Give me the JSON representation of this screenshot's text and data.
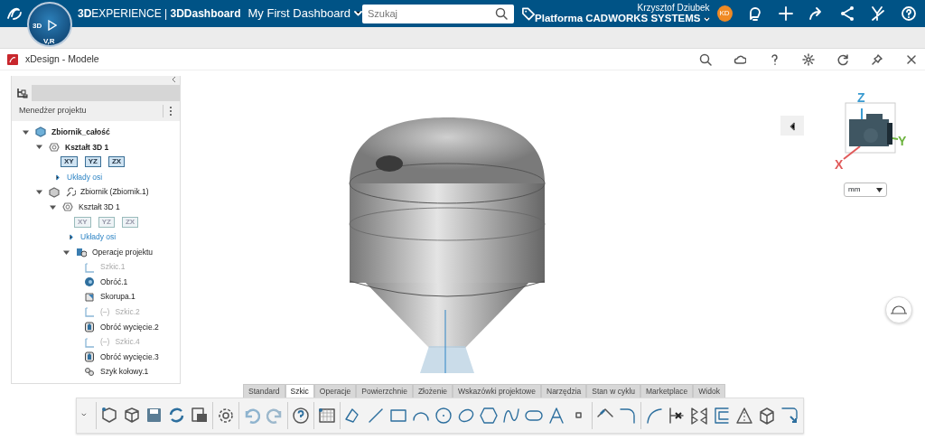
{
  "topbar": {
    "brand": "**3D**EXPERIENCE | **3DDashboard**",
    "dashboard_title": "My First Dashboard",
    "search": {
      "placeholder": "Szukaj"
    },
    "user": {
      "name": "Krzysztof Dziubek",
      "platform": "Platforma CADWORKS SYSTEMS",
      "initials": "KD"
    }
  },
  "compass": {
    "labels": [
      "3D",
      "V,R"
    ]
  },
  "widget": {
    "title": "xDesign - Modele"
  },
  "tree_panel": {
    "title": "Menedżer projektu",
    "tree": [
      {
        "kind": "assembly",
        "label": "Zbiornik_całość",
        "bold": true,
        "expanded": true,
        "children": [
          {
            "kind": "body",
            "label": "Kształt 3D 1",
            "bold": true,
            "expanded": true,
            "children": [
              {
                "kind": "planes",
                "dimmed": false,
                "planes": [
                  "XY",
                  "YZ",
                  "ZX"
                ]
              },
              {
                "kind": "link",
                "label": "Układy osi",
                "expanded": false
              }
            ]
          },
          {
            "kind": "part",
            "label": "Zbiornik (Zbiornik.1)",
            "bold": false,
            "expanded": true,
            "children": [
              {
                "kind": "body",
                "label": "Kształt 3D 1",
                "bold": false,
                "expanded": true,
                "children": [
                  {
                    "kind": "planes",
                    "dimmed": true,
                    "planes": [
                      "XY",
                      "YZ",
                      "ZX"
                    ]
                  },
                  {
                    "kind": "link",
                    "label": "Układy osi",
                    "expanded": false
                  },
                  {
                    "kind": "group",
                    "label": "Operacje projektu",
                    "bold": false,
                    "expanded": true,
                    "children": [
                      {
                        "kind": "sketch",
                        "label": "Szkic.1",
                        "dimmed": true
                      },
                      {
                        "kind": "revolve",
                        "label": "Obróć.1",
                        "dimmed": false
                      },
                      {
                        "kind": "shell",
                        "label": "Skorupa.1",
                        "dimmed": false
                      },
                      {
                        "kind": "sketch",
                        "mark": "(–)",
                        "label": "Szkic.2",
                        "dimmed": true
                      },
                      {
                        "kind": "cut",
                        "label": "Obróć wycięcie.2",
                        "dimmed": false
                      },
                      {
                        "kind": "sketch",
                        "mark": "(–)",
                        "label": "Szkic.4",
                        "dimmed": true
                      },
                      {
                        "kind": "cut",
                        "label": "Obróć wycięcie.3",
                        "dimmed": false
                      },
                      {
                        "kind": "pattern",
                        "label": "Szyk kołowy.1",
                        "dimmed": false
                      }
                    ]
                  }
                ]
              }
            ]
          }
        ]
      }
    ]
  },
  "view_cube": {
    "axes": [
      "Z",
      "X",
      "Y"
    ]
  },
  "units": {
    "value": "mm"
  },
  "toolbar": {
    "tabs": [
      {
        "label": "Standard",
        "selected": false
      },
      {
        "label": "Szkic",
        "selected": true
      },
      {
        "label": "Operacje",
        "selected": false
      },
      {
        "label": "Powierzchnie",
        "selected": false
      },
      {
        "label": "Złożenie",
        "selected": false
      },
      {
        "label": "Wskazówki projektowe",
        "selected": false
      },
      {
        "label": "Narzędzia",
        "selected": false
      },
      {
        "label": "Stan w cyklu",
        "selected": false
      },
      {
        "label": "Marketplace",
        "selected": false
      },
      {
        "label": "Widok",
        "selected": false
      }
    ]
  }
}
